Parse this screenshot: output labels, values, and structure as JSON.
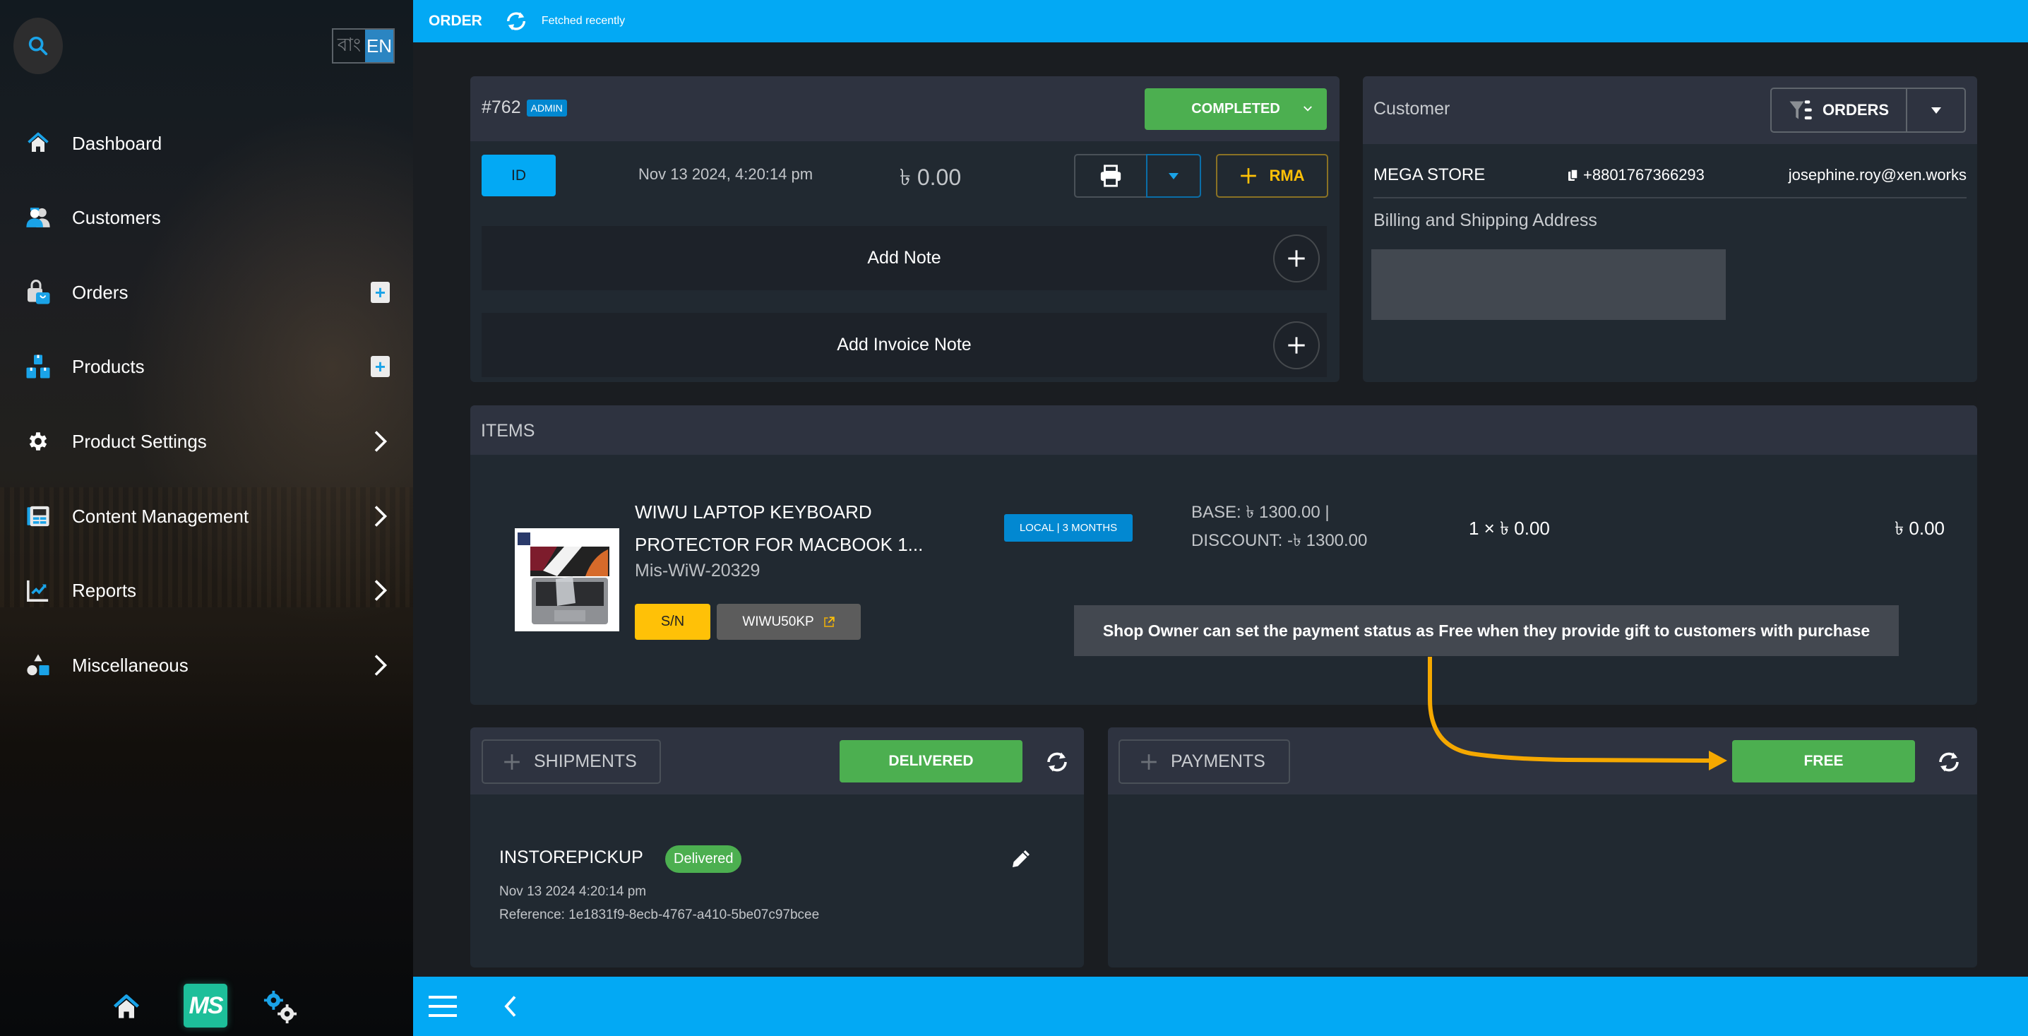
{
  "sidebar": {
    "language": {
      "bangla": "বাং",
      "english": "EN",
      "active": "EN"
    },
    "items": [
      {
        "label": "Dashboard",
        "icon": "home-icon",
        "action": null
      },
      {
        "label": "Customers",
        "icon": "customers-icon",
        "action": null
      },
      {
        "label": "Orders",
        "icon": "orders-bag-icon",
        "action": "add"
      },
      {
        "label": "Products",
        "icon": "products-boxes-icon",
        "action": "add"
      },
      {
        "label": "Product Settings",
        "icon": "gear-icon",
        "action": "expand"
      },
      {
        "label": "Content Management",
        "icon": "content-icon",
        "action": "expand"
      },
      {
        "label": "Reports",
        "icon": "chart-icon",
        "action": "expand"
      },
      {
        "label": "Miscellaneous",
        "icon": "shapes-icon",
        "action": "expand"
      }
    ],
    "bottom": {
      "logo_text": "MS"
    }
  },
  "topbar": {
    "title": "ORDER",
    "status": "Fetched recently"
  },
  "order": {
    "number": "#762",
    "source_badge": "ADMIN",
    "status": "COMPLETED",
    "id_label": "ID",
    "date": "Nov 13 2024, 4:20:14 pm",
    "total": "৳ 0.00",
    "rma_label": "RMA",
    "add_note_label": "Add Note",
    "add_invoice_note_label": "Add Invoice Note"
  },
  "customer": {
    "title": "Customer",
    "orders_label": "ORDERS",
    "name": "MEGA STORE",
    "phone": "+8801767366293",
    "email": "josephine.roy@xen.works",
    "address_title": "Billing and Shipping Address"
  },
  "items": {
    "title": "ITEMS",
    "list": [
      {
        "name_line1": "WIWU LAPTOP KEYBOARD",
        "name_line2": "PROTECTOR FOR MACBOOK 1...",
        "sku": "Mis-WiW-20329",
        "sn_label": "S/N",
        "code": "WIWU50KP",
        "warranty": "LOCAL | 3 MONTHS",
        "base": "BASE: ৳ 1300.00 |",
        "discount": "DISCOUNT: -৳ 1300.00",
        "qty_price": "1 × ৳ 0.00",
        "line_total": "৳ 0.00"
      }
    ]
  },
  "annotation": {
    "text": "Shop Owner can set the payment status as Free when they provide gift to customers with purchase",
    "color": "#f5a800"
  },
  "shipments": {
    "title": "SHIPMENTS",
    "status": "DELIVERED",
    "entries": [
      {
        "method": "INSTOREPICKUP",
        "badge": "Delivered",
        "date": "Nov 13 2024 4:20:14 pm",
        "reference": "Reference: 1e1831f9-8ecb-4767-a410-5be07c97bcee"
      }
    ]
  },
  "payments": {
    "title": "PAYMENTS",
    "status": "FREE"
  },
  "colors": {
    "accent": "#03a9f4",
    "success": "#4caf50",
    "warning": "#ffc107",
    "panel": "#212931",
    "panel_header": "#2e3340"
  }
}
